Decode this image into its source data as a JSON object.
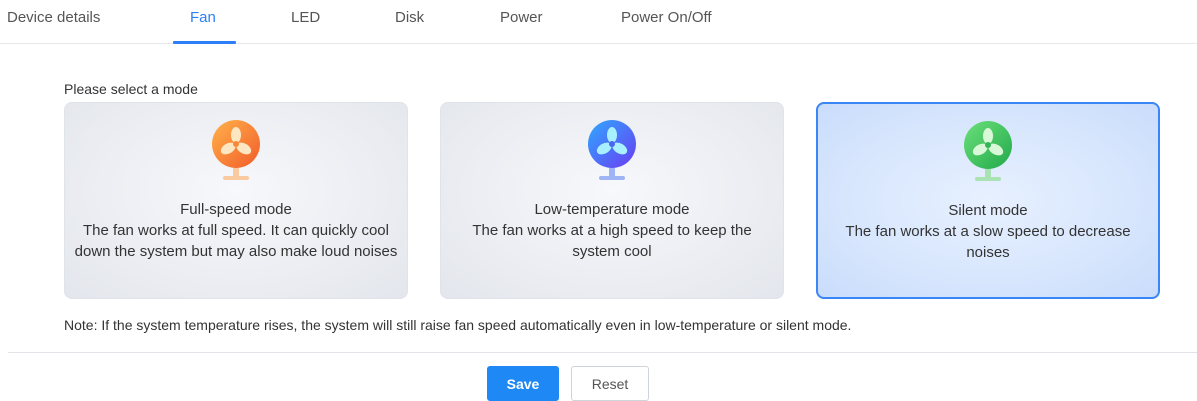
{
  "tabs": [
    {
      "label": "Device details"
    },
    {
      "label": "Fan"
    },
    {
      "label": "LED"
    },
    {
      "label": "Disk"
    },
    {
      "label": "Power"
    },
    {
      "label": "Power On/Off"
    }
  ],
  "active_tab": "Fan",
  "prompt": "Please select a mode",
  "modes": [
    {
      "title": "Full-speed mode",
      "description": "The fan works at full speed. It can quickly cool down the system but may also make loud noises",
      "icon": "fan-orange-icon",
      "color": "#f6843a"
    },
    {
      "title": "Low-temperature mode",
      "description": "The fan works at a high speed to keep the system cool",
      "icon": "fan-blue-icon",
      "color": "#3f6cf0"
    },
    {
      "title": "Silent mode",
      "description": "The fan works at a slow speed to decrease noises",
      "icon": "fan-green-icon",
      "color": "#3cc25a"
    }
  ],
  "selected_mode": "Silent mode",
  "note": "Note: If the system temperature rises, the system will still raise fan speed automatically even in low-temperature or silent mode.",
  "buttons": {
    "save": "Save",
    "reset": "Reset"
  },
  "colors": {
    "accent": "#2d7ff9",
    "save_button": "#1e88f5"
  }
}
